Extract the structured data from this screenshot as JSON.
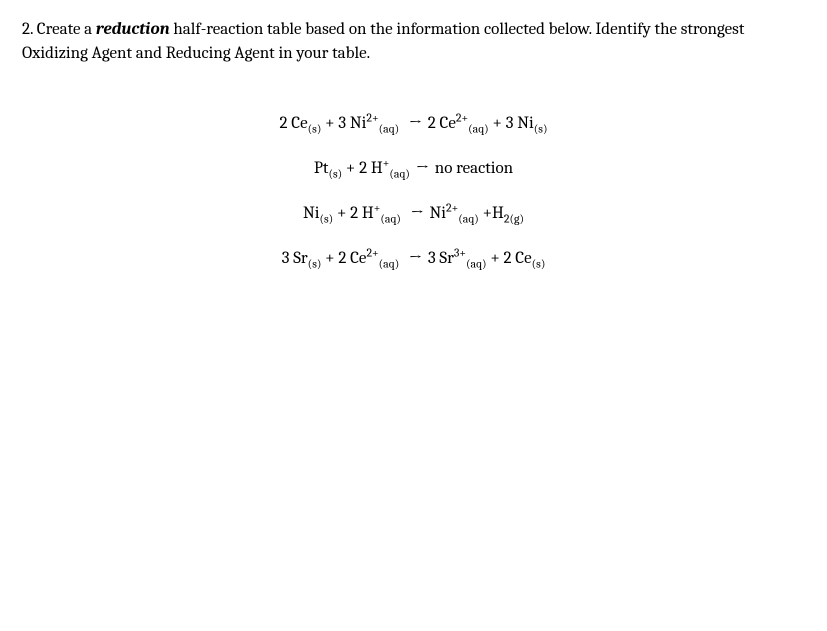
{
  "question": {
    "number": "2.",
    "prefix": "Create a ",
    "emphasis": "reduction",
    "suffix": " half-reaction table based on the information collected below.  Identify the strongest Oxidizing Agent and Reducing Agent in your table."
  },
  "equations": {
    "eq1": {
      "left_coef1": "2",
      "species1": "Ce",
      "state1": "(s)",
      "plus1": " + ",
      "left_coef2": "3",
      "species2": "Ni",
      "charge2": "2+",
      "state2": "(aq)",
      "arrow": "→",
      "right_coef1": "2",
      "species3": "Ce",
      "charge3": "2+",
      "state3": "(aq)",
      "plus2": " + ",
      "right_coef2": "3",
      "species4": "Ni",
      "state4": "(s)"
    },
    "eq2": {
      "species1": "Pt",
      "state1": "(s)",
      "plus1": " + ",
      "left_coef2": "2",
      "species2": "H",
      "charge2": "+",
      "state2": "(aq)",
      "arrow": "→",
      "result": "no reaction"
    },
    "eq3": {
      "species1": "Ni",
      "state1": "(s)",
      "plus1": " + ",
      "left_coef2": "2",
      "species2": "H",
      "charge2": "+",
      "state2": "(aq)",
      "arrow": "→",
      "species3": "Ni",
      "charge3": "2+",
      "state3": "(aq)",
      "plus2": "  +",
      "species4": "H",
      "sub4": "2",
      "state4": "(g)"
    },
    "eq4": {
      "left_coef1": "3",
      "species1": "Sr",
      "state1": "(s)",
      "plus1": " + ",
      "left_coef2": "2",
      "species2": "Ce",
      "charge2": "2+",
      "state2": "(aq)",
      "arrow": "→",
      "right_coef1": "3",
      "species3": "Sr",
      "charge3": "3+",
      "state3": "(aq)",
      "plus2": " + ",
      "right_coef2": "2",
      "species4": "Ce",
      "state4": "(s)"
    }
  }
}
